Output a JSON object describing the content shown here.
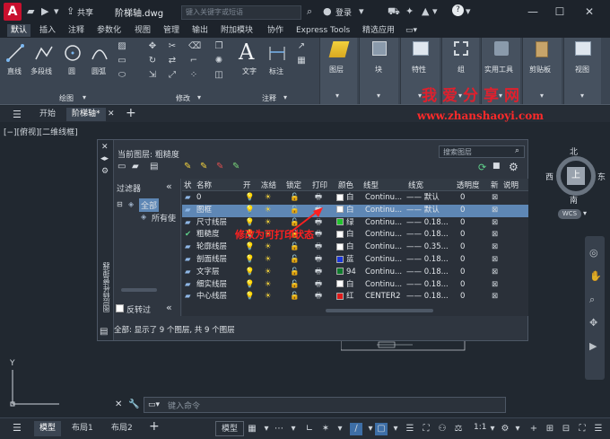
{
  "app": {
    "logo": "A",
    "filename": "阶梯轴.dwg",
    "share_label": "共享",
    "search_placeholder": "键入关键字或短语",
    "login_label": "登录"
  },
  "ribbon_tabs": [
    "默认",
    "插入",
    "注释",
    "参数化",
    "视图",
    "管理",
    "输出",
    "附加模块",
    "协作",
    "Express Tools",
    "精选应用"
  ],
  "ribbon": {
    "draw": {
      "title": "绘图",
      "line": "直线",
      "polyline": "多段线",
      "circle": "圆",
      "arc": "圆弧"
    },
    "modify": {
      "title": "修改"
    },
    "annotation": {
      "title": "注释",
      "text": "文字",
      "dimension": "标注"
    },
    "big_buttons": [
      "图层",
      "块",
      "特性",
      "组",
      "实用工具",
      "剪贴板",
      "视图"
    ]
  },
  "doc_tabs": {
    "start": "开始",
    "current": "阶梯轴*",
    "add": "+"
  },
  "viewport_label": "[−][俯视][二维线框]",
  "palette": {
    "strip_label": "图层特性管理器",
    "current_layer": "当前图层: 粗糙度",
    "search_placeholder": "搜索图层",
    "filter_title": "过滤器",
    "tree_all": "全部",
    "tree_used": "所有使",
    "invert_filter": "反转过",
    "headers": [
      "状",
      "名称",
      "开",
      "冻结",
      "锁定",
      "打印",
      "颜色",
      "线型",
      "线宽",
      "透明度",
      "新",
      "说明"
    ],
    "rows": [
      {
        "name": "0",
        "color_hex": "#ffffff",
        "color": "白",
        "linetype": "Continu...",
        "lineweight": "—— 默认",
        "transparency": "0"
      },
      {
        "name": "图框",
        "color_hex": "#ffffff",
        "color": "白",
        "linetype": "Continu...",
        "lineweight": "—— 默认",
        "transparency": "0"
      },
      {
        "name": "尺寸线层",
        "color_hex": "#22c32e",
        "color": "绿",
        "linetype": "Continu...",
        "lineweight": "—— 0.18...",
        "transparency": "0"
      },
      {
        "name": "粗糙度",
        "color_hex": "#ffffff",
        "color": "白",
        "linetype": "Continu...",
        "lineweight": "—— 0.18...",
        "transparency": "0"
      },
      {
        "name": "轮廓线层",
        "color_hex": "#ffffff",
        "color": "白",
        "linetype": "Continu...",
        "lineweight": "—— 0.35...",
        "transparency": "0"
      },
      {
        "name": "剖面线层",
        "color_hex": "#1a36d8",
        "color": "蓝",
        "linetype": "Continu...",
        "lineweight": "—— 0.18...",
        "transparency": "0"
      },
      {
        "name": "文字层",
        "color_hex": "#0e7a2c",
        "color": "94",
        "linetype": "Continu...",
        "lineweight": "—— 0.18...",
        "transparency": "0"
      },
      {
        "name": "细实线层",
        "color_hex": "#ffffff",
        "color": "白",
        "linetype": "Continu...",
        "lineweight": "—— 0.18...",
        "transparency": "0"
      },
      {
        "name": "中心线层",
        "color_hex": "#e01a1a",
        "color": "红",
        "linetype": "CENTER2",
        "lineweight": "—— 0.18...",
        "transparency": "0"
      }
    ],
    "status": "全部: 显示了 9 个图层, 共 9 个图层"
  },
  "viewcube": {
    "north": "北",
    "south": "南",
    "east": "东",
    "west": "西",
    "top": "上",
    "wcs": "WCS"
  },
  "ucs": {
    "y": "Y"
  },
  "cmdline_placeholder": "键入命令",
  "status_tabs": {
    "model": "模型",
    "layout1": "布局1",
    "layout2": "布局2",
    "add": "+"
  },
  "status_right": {
    "model_btn": "模型",
    "scale": "1:1"
  },
  "annotation_text": "修改为可打印状态",
  "watermark": {
    "title": "我爱分享网",
    "url": "www.zhanshaoyi.com"
  }
}
